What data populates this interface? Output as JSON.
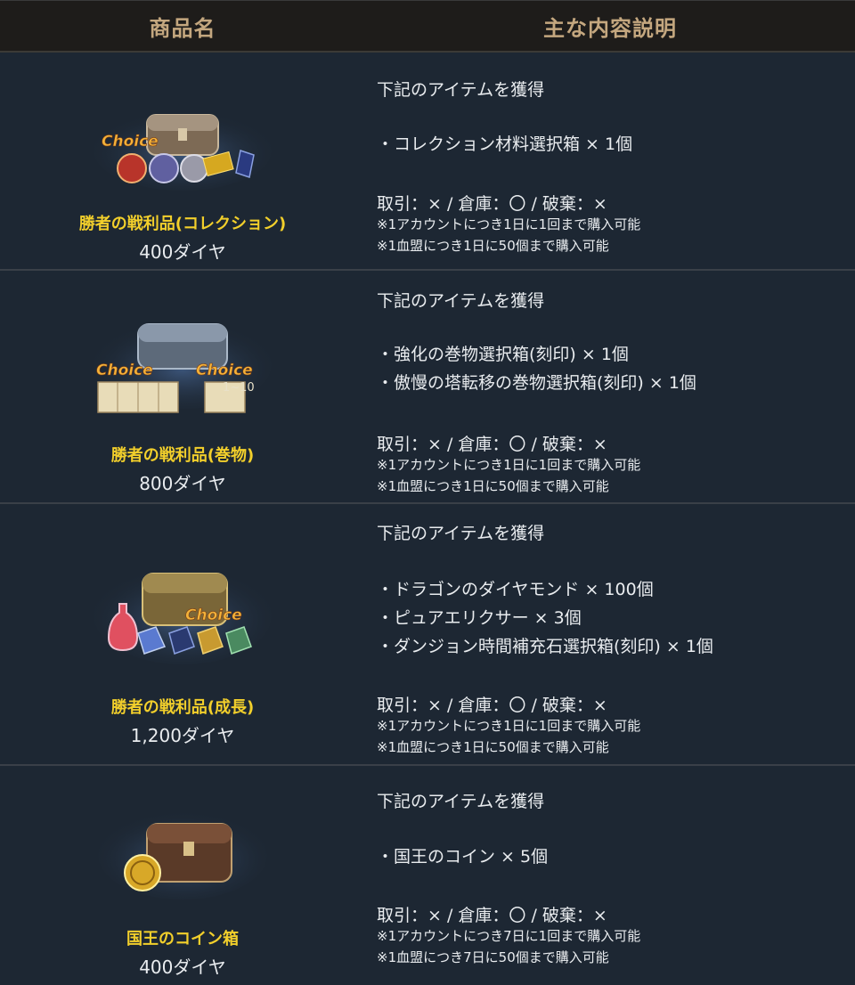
{
  "header": {
    "col_name": "商品名",
    "col_desc": "主な内容説明"
  },
  "products": [
    {
      "name": "勝者の戦利品(コレクション)",
      "price": "400ダイヤ",
      "icon": "collection-chest-icon",
      "badges": [
        "Choice"
      ],
      "desc_head": "下記のアイテムを獲得",
      "items": [
        "・コレクション材料選択箱 × 1個"
      ],
      "trade": "取引：× / 倉庫：〇 / 破棄：×",
      "notes": [
        "※1アカウントにつき1日に1回まで購入可能",
        "※1血盟につき1日に50個まで購入可能"
      ]
    },
    {
      "name": "勝者の戦利品(巻物)",
      "price": "800ダイヤ",
      "icon": "scroll-chest-icon",
      "badges": [
        "Choice",
        "Choice",
        "1~10"
      ],
      "desc_head": "下記のアイテムを獲得",
      "items": [
        "・強化の巻物選択箱(刻印) × 1個",
        "・傲慢の塔転移の巻物選択箱(刻印) × 1個"
      ],
      "trade": "取引：× / 倉庫：〇 / 破棄：×",
      "notes": [
        "※1アカウントにつき1日に1回まで購入可能",
        "※1血盟につき1日に50個まで購入可能"
      ]
    },
    {
      "name": "勝者の戦利品(成長)",
      "price": "1,200ダイヤ",
      "icon": "growth-chest-icon",
      "badges": [
        "Choice"
      ],
      "desc_head": "下記のアイテムを獲得",
      "items": [
        "・ドラゴンのダイヤモンド × 100個",
        "・ピュアエリクサー × 3個",
        "・ダンジョン時間補充石選択箱(刻印) × 1個"
      ],
      "trade": "取引：× / 倉庫：〇 / 破棄：×",
      "notes": [
        "※1アカウントにつき1日に1回まで購入可能",
        "※1血盟につき1日に50個まで購入可能"
      ]
    },
    {
      "name": "国王のコイン箱",
      "price": "400ダイヤ",
      "icon": "king-coin-chest-icon",
      "badges": [],
      "desc_head": "下記のアイテムを獲得",
      "items": [
        "・国王のコイン × 5個"
      ],
      "trade": "取引：× / 倉庫：〇 / 破棄：×",
      "notes": [
        "※1アカウントにつき7日に1回まで購入可能",
        "※1血盟につき7日に50個まで購入可能"
      ]
    }
  ],
  "colors": {
    "header_bg": "#1e1c1a",
    "header_text": "#c4a77f",
    "row_bg": "#1d2733",
    "name": "#f2cf2b",
    "divider": "#3a4048"
  }
}
